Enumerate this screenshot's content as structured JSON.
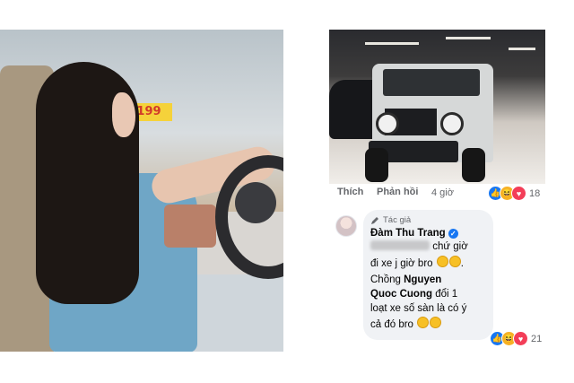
{
  "left_photo": {
    "sign_text": "199",
    "sign_text_left": "99"
  },
  "post": {
    "actions": {
      "like": "Thích",
      "reply": "Phản hồi",
      "time": "4 giờ"
    },
    "reaction_count": "18",
    "reactions": [
      "like-icon",
      "haha-icon",
      "love-icon"
    ]
  },
  "comment": {
    "tag": "Tác giả",
    "author": "Đàm Thu Trang",
    "line1_after_blur": "chứ giờ",
    "line2": "đi xe j giờ bro",
    "line3": "Chồng",
    "line3_bold": "Nguyen",
    "line4_bold": "Quoc Cuong",
    "line4_rest": "đổi 1",
    "line5": "loạt xe số sàn là có ý",
    "line6": "cả đó bro",
    "reaction_count": "21",
    "reactions": [
      "like-icon",
      "haha-icon",
      "love-icon"
    ]
  },
  "colors": {
    "facebook_blue": "#1877f2",
    "bubble_bg": "#f0f2f5",
    "meta_text": "#65676b"
  }
}
